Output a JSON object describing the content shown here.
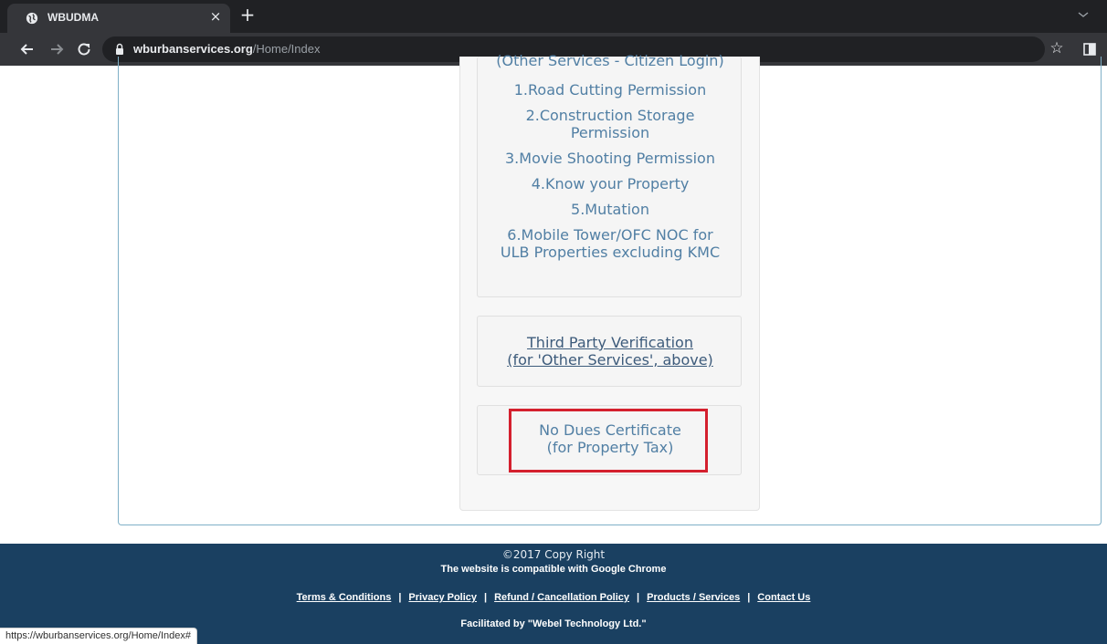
{
  "browser": {
    "tab_title": "WBUDMA",
    "close_glyph": "×",
    "new_tab_glyph": "+",
    "url_host": "wburbanservices.org",
    "url_path": "/Home/Index",
    "star_glyph": "☆",
    "status_url": "https://wburbanservices.org/Home/Index#"
  },
  "services": {
    "header": "(Other Services - Citizen Login)",
    "items": [
      {
        "label_line1": "1.Road Cutting Permission",
        "label_line2": ""
      },
      {
        "label_line1": "2.Construction Storage",
        "label_line2": "Permission"
      },
      {
        "label_line1": "3.Movie Shooting Permission",
        "label_line2": ""
      },
      {
        "label_line1": "4.Know your Property",
        "label_line2": ""
      },
      {
        "label_line1": "5.Mutation",
        "label_line2": ""
      },
      {
        "label_line1": "6.Mobile Tower/OFC NOC for",
        "label_line2": "ULB Properties excluding KMC"
      }
    ]
  },
  "third_party": {
    "line1": "Third Party Verification",
    "line2": "(for 'Other Services', above)"
  },
  "no_dues": {
    "line1": "No Dues Certificate",
    "line2": "(for Property Tax)"
  },
  "footer": {
    "copyright": "©2017 Copy Right",
    "compat": "The website is compatible with Google Chrome",
    "links": [
      "Terms & Conditions",
      "Privacy Policy",
      "Refund / Cancellation Policy",
      "Products / Services",
      "Contact Us"
    ],
    "separator": "|",
    "facilitated": "Facilitated by \"Webel Technology Ltd.\""
  },
  "colors": {
    "link": "#517fa4",
    "footer_bg": "#1a4061",
    "highlight": "#d4202e"
  }
}
